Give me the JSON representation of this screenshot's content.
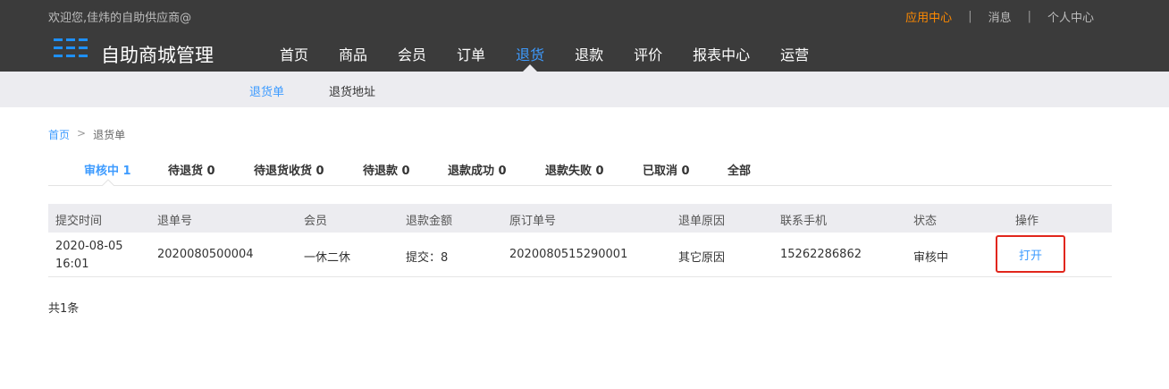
{
  "header": {
    "welcome": "欢迎您,佳炜的自助供应商@",
    "links": [
      {
        "label": "应用中心",
        "active": true
      },
      {
        "label": "消息",
        "active": false
      },
      {
        "label": "个人中心",
        "active": false
      }
    ],
    "brand": "自助商城管理",
    "brand_color": "#1e90ff",
    "nav": [
      "首页",
      "商品",
      "会员",
      "订单",
      "退货",
      "退款",
      "评价",
      "报表中心",
      "运营"
    ],
    "active_nav": "退货"
  },
  "subnav": {
    "items": [
      "退货单",
      "退货地址"
    ],
    "active": "退货单"
  },
  "breadcrumb": {
    "home": "首页",
    "separator": ">",
    "current": "退货单"
  },
  "tabs": [
    "审核中 1",
    "待退货 0",
    "待退货收货 0",
    "待退款 0",
    "退款成功 0",
    "退款失败 0",
    "已取消 0",
    "全部"
  ],
  "active_tab": "审核中 1",
  "table": {
    "headers": [
      "提交时间",
      "退单号",
      "会员",
      "退款金额",
      "原订单号",
      "退单原因",
      "联系手机",
      "状态",
      "操作"
    ],
    "rows": [
      {
        "submit_time": "2020-08-05 16:01",
        "return_no": "2020080500004",
        "member": "一休二休",
        "refund_amount": "提交：8",
        "order_no": "2020080515290001",
        "reason": "其它原因",
        "phone": "15262286862",
        "status": "审核中",
        "action": "打开"
      }
    ]
  },
  "total": "共1条",
  "colors": {
    "accent": "#3d9bff",
    "highlight_orange": "#ff8a00",
    "action_outline": "#e1261c"
  }
}
